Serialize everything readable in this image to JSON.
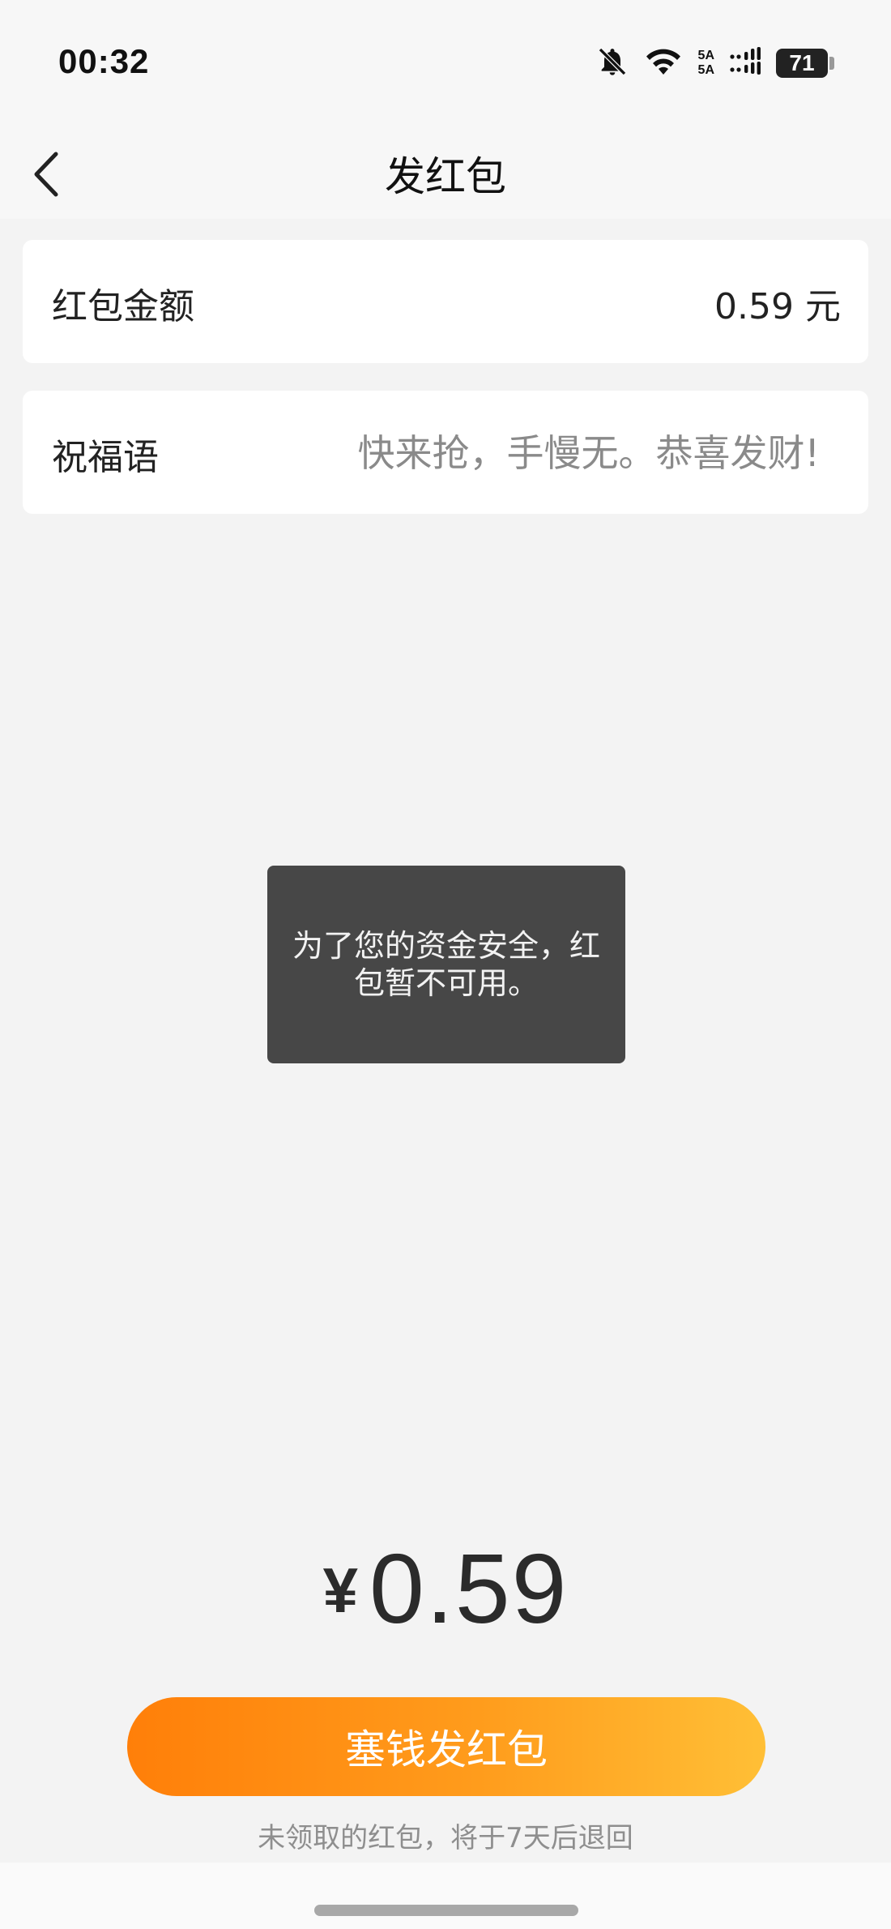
{
  "status_bar": {
    "time": "00:32",
    "network_top": "5A",
    "network_bottom": "5A",
    "battery": "71",
    "icons": [
      "bell-off-icon",
      "wifi-icon",
      "signal-icon",
      "battery-icon"
    ]
  },
  "nav": {
    "title": "发红包",
    "back_icon": "chevron-left-icon"
  },
  "amount_row": {
    "label": "红包金额",
    "value": "0.59 元"
  },
  "greeting_row": {
    "label": "祝福语",
    "placeholder": "快来抢，手慢无。恭喜发财!"
  },
  "toast": {
    "message": "为了您的资金安全，红包暂不可用。"
  },
  "total": {
    "currency": "¥",
    "amount": "0.59"
  },
  "send_button": {
    "label": "塞钱发红包"
  },
  "footnote": "未领取的红包，将于7天后退回",
  "colors": {
    "accent_start": "#ff7f09",
    "accent_end": "#ffbf36",
    "background": "#f3f3f3",
    "toast": "#474747"
  }
}
